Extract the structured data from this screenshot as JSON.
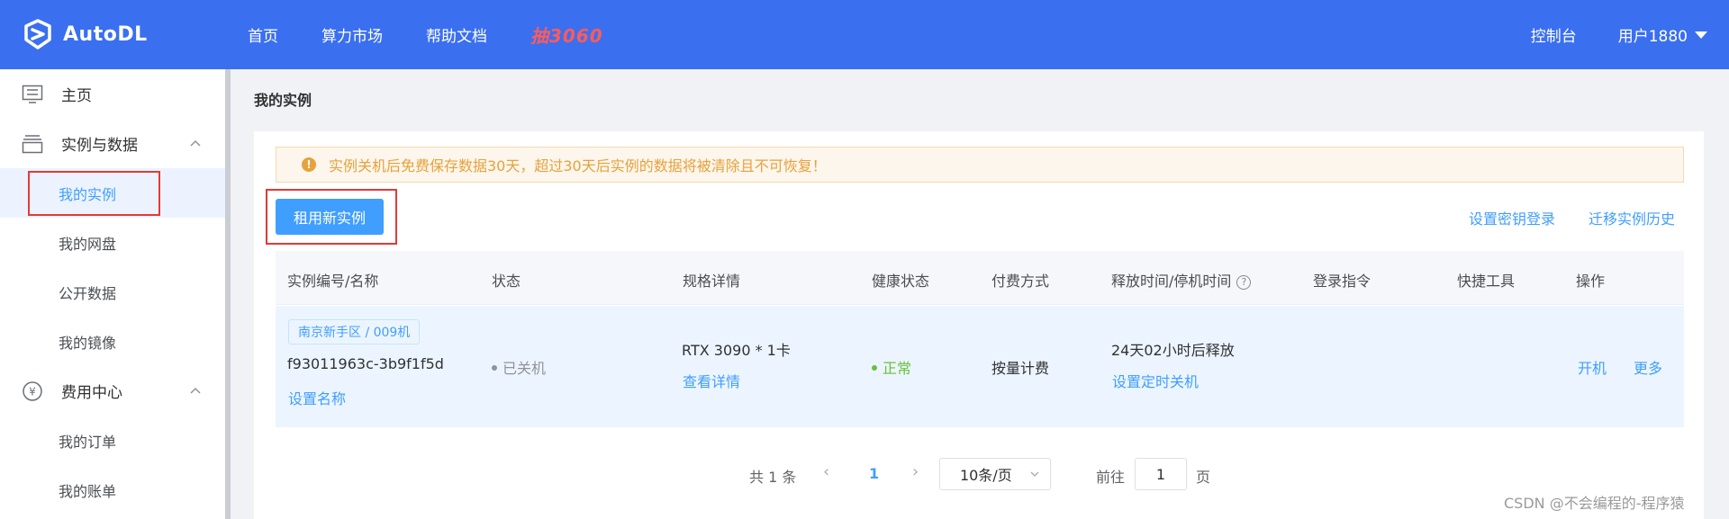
{
  "brand": {
    "name": "AutoDL"
  },
  "nav": {
    "items": [
      "首页",
      "算力市场",
      "帮助文档"
    ],
    "promo": "抽3060"
  },
  "header": {
    "console": "控制台",
    "user": "用户1880"
  },
  "sidebar": {
    "home": "主页",
    "instances_group": "实例与数据",
    "my_instances": "我的实例",
    "my_disk": "我的网盘",
    "public_data": "公开数据",
    "my_images": "我的镜像",
    "billing_group": "费用中心",
    "my_orders": "我的订单",
    "my_account": "我的账单",
    "billing_icon_glyph": "¥"
  },
  "main": {
    "title": "我的实例",
    "alert": "实例关机后免费保存数据30天，超过30天后实例的数据将被清除且不可恢复！",
    "alert_icon": "!",
    "rent_button": "租用新实例",
    "set_key_login": "设置密钥登录",
    "migrate_history": "迁移实例历史"
  },
  "table": {
    "headers": [
      "实例编号/名称",
      "状态",
      "规格详情",
      "健康状态",
      "付费方式",
      "释放时间/停机时间",
      "登录指令",
      "快捷工具",
      "操作"
    ],
    "help_glyph": "?",
    "row": {
      "region": "南京新手区 / 009机",
      "instance_id": "f93011963c-3b9f1f5d",
      "set_name": "设置名称",
      "status": "已关机",
      "spec": "RTX 3090 * 1卡",
      "view_details": "查看详情",
      "health": "正常",
      "billing": "按量计费",
      "release": "24天02小时后释放",
      "set_shutdown": "设置定时关机",
      "action_start": "开机",
      "action_more": "更多"
    }
  },
  "pagination": {
    "total": "共 1 条",
    "prev": "‹",
    "next": "›",
    "current": "1",
    "page_size": "10条/页",
    "goto": "前往",
    "goto_value": "1",
    "page_unit": "页"
  },
  "watermark": "CSDN @不会编程的-程序猿",
  "colors": {
    "topbar": "#3a6ff0",
    "primary": "#409eff",
    "warning": "#e6a23c",
    "success": "#67c23a",
    "highlight": "#e53935"
  }
}
